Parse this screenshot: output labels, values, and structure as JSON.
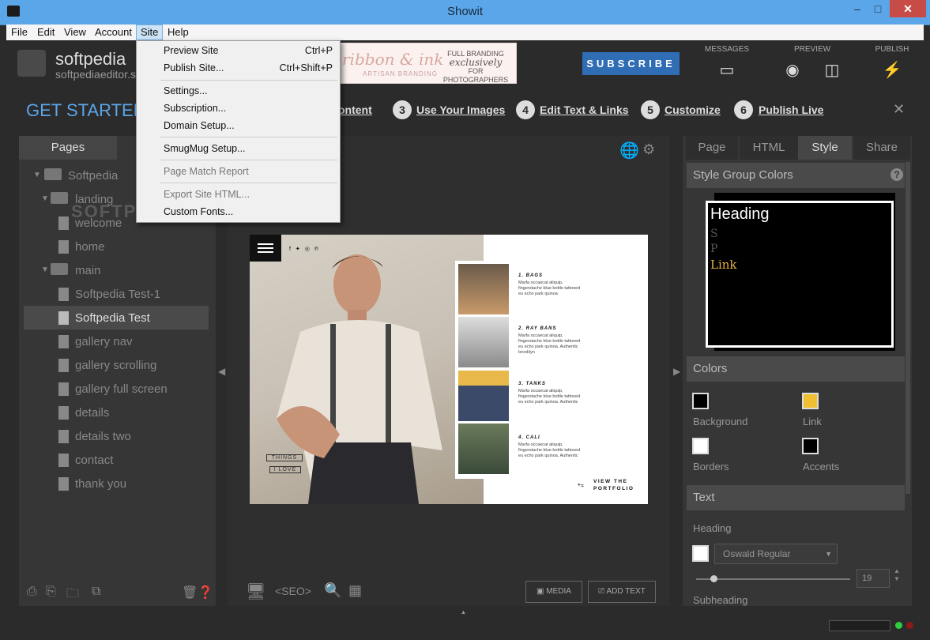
{
  "window": {
    "title": "Showit",
    "minimize": "–",
    "maximize": "□",
    "close": "✕"
  },
  "menubar": [
    "File",
    "Edit",
    "View",
    "Account",
    "Site",
    "Help"
  ],
  "header": {
    "site_name": "softpedia",
    "site_sub": "softpediaeditor.s",
    "banner_left": "ribbon & ink",
    "banner_left_sub": "ARTISAN BRANDING",
    "banner_right": [
      "FULL BRANDING",
      "exclusively",
      "FOR PHOTOGRAPHERS"
    ],
    "subscribe": "SUBSCRIBE",
    "messages": "MESSAGES",
    "preview": "PREVIEW",
    "publish": "PUBLISH"
  },
  "get_started": {
    "title": "GET STARTED",
    "partial_step": "ontent",
    "steps": [
      {
        "num": "3",
        "label": "Use Your Images"
      },
      {
        "num": "4",
        "label": "Edit Text & Links"
      },
      {
        "num": "5",
        "label": "Customize"
      },
      {
        "num": "6",
        "label": "Publish Live"
      }
    ],
    "close": "✕"
  },
  "site_menu": [
    {
      "label": "Preview Site",
      "shortcut": "Ctrl+P",
      "disabled": false
    },
    {
      "label": "Publish Site...",
      "shortcut": "Ctrl+Shift+P",
      "disabled": false
    },
    {
      "label": "Settings...",
      "shortcut": "",
      "disabled": false
    },
    {
      "label": "Subscription...",
      "shortcut": "",
      "disabled": false
    },
    {
      "label": "Domain Setup...",
      "shortcut": "",
      "disabled": false
    },
    {
      "label": "SmugMug Setup...",
      "shortcut": "",
      "disabled": false
    },
    {
      "label": "Page Match Report",
      "shortcut": "",
      "disabled": true
    },
    {
      "label": "Export Site HTML...",
      "shortcut": "",
      "disabled": true
    },
    {
      "label": "Custom Fonts...",
      "shortcut": "",
      "disabled": false
    }
  ],
  "pages_panel": {
    "tab": "Pages",
    "partial_tab_text": "t",
    "tree": [
      {
        "label": "Softpedia",
        "type": "folder"
      },
      {
        "label": "landing",
        "type": "folder"
      },
      {
        "label": "welcome",
        "type": "home"
      },
      {
        "label": "home",
        "type": "page"
      },
      {
        "label": "main",
        "type": "folder"
      },
      {
        "label": "Softpedia Test-1",
        "type": "page"
      },
      {
        "label": "Softpedia Test",
        "type": "page",
        "active": true
      },
      {
        "label": "gallery nav",
        "type": "page"
      },
      {
        "label": "gallery scrolling",
        "type": "page"
      },
      {
        "label": "gallery full screen",
        "type": "page"
      },
      {
        "label": "details",
        "type": "page"
      },
      {
        "label": "details two",
        "type": "page"
      },
      {
        "label": "contact",
        "type": "page"
      },
      {
        "label": "thank you",
        "type": "page"
      }
    ]
  },
  "canvas": {
    "social": "f  ✦  ◎  ℗",
    "items": [
      {
        "title": "1. BAGS",
        "body": "Marfa occaecat aliquip, fingerstache blue bottle tattooed eu echo park quinoa"
      },
      {
        "title": "2. RAY BANS",
        "body": "Marfa occaecat aliquip, fingerstache blue bottle tattooed eu echo park quinoa. Authentic brooklyn"
      },
      {
        "title": "3. TANKS",
        "body": "Marfa occaecat aliquip, fingerstache blue bottle tattooed eu echo park quinoa. Authentic"
      },
      {
        "title": "4. CALI",
        "body": "Marfa occaecat aliquip, fingerstache blue bottle tattooed eu echo park quinoa. Authentic"
      }
    ],
    "things": "THINGS",
    "i_love": "I LOVE",
    "view_portfolio": [
      "VIEW THE",
      "PORTFOLIO"
    ]
  },
  "center_toolbar": {
    "seo": "<SEO>",
    "media": "MEDIA",
    "add_text": "ADD TEXT"
  },
  "style_panel": {
    "tabs": [
      "Page",
      "HTML",
      "Style",
      "Share"
    ],
    "style_group_colors": "Style Group Colors",
    "preview_heading": "Heading",
    "preview_s": "S",
    "preview_p": "P",
    "preview_link": "Link",
    "colors_head": "Colors",
    "swatches": [
      {
        "label": "Background",
        "color": "#000000"
      },
      {
        "label": "Link",
        "color": "#f0c030"
      },
      {
        "label": "Borders",
        "color": "#ffffff"
      },
      {
        "label": "Accents",
        "color": "#000000"
      }
    ],
    "text_head": "Text",
    "heading_label": "Heading",
    "font": "Oswald Regular",
    "font_size": "19",
    "subheading_label": "Subheading",
    "help": "?"
  },
  "watermark": "SOFTPEDIA"
}
